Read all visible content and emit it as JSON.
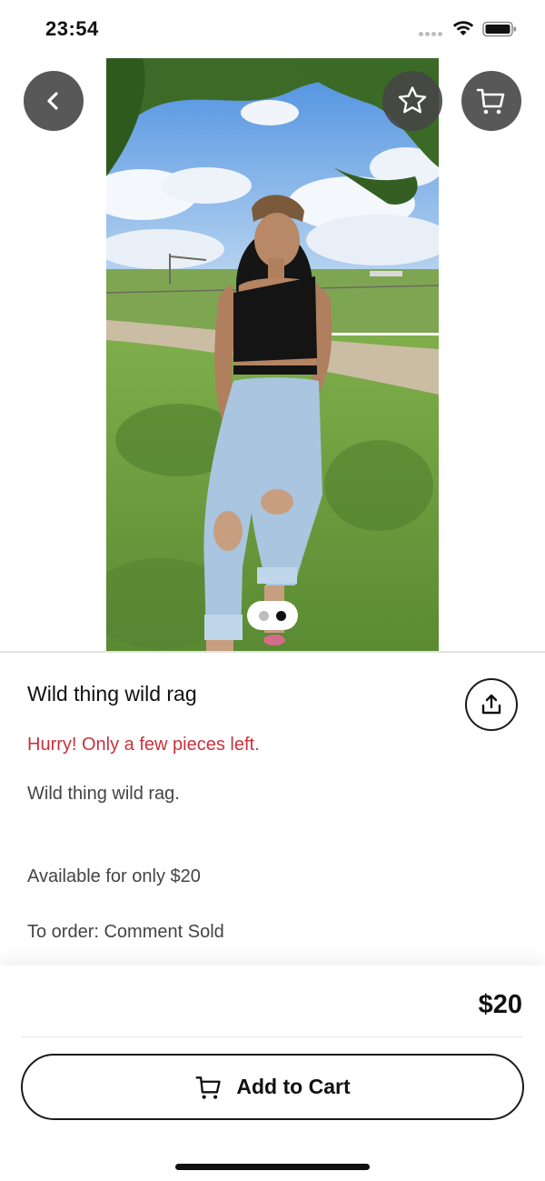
{
  "status_bar": {
    "time": "23:54",
    "icons": [
      "signal-dots-icon",
      "wifi-icon",
      "battery-icon"
    ]
  },
  "nav": {
    "icons": {
      "back": "chevron-left-icon",
      "favorite": "star-icon",
      "cart": "cart-icon"
    }
  },
  "gallery": {
    "image_count": 2,
    "active_index": 1
  },
  "product": {
    "title": "Wild thing wild rag",
    "stock_warning": "Hurry! Only a few pieces left.",
    "description": [
      "Wild thing wild rag.",
      "Available for only $20",
      "To order: Comment Sold"
    ],
    "share_icon": "share-icon"
  },
  "footer": {
    "price": "$20",
    "add_to_cart_label": "Add to Cart",
    "add_to_cart_icon": "cart-icon"
  },
  "colors": {
    "warning": "#c8323c",
    "text": "#1a1a1a",
    "overlay_button": "#464646"
  }
}
